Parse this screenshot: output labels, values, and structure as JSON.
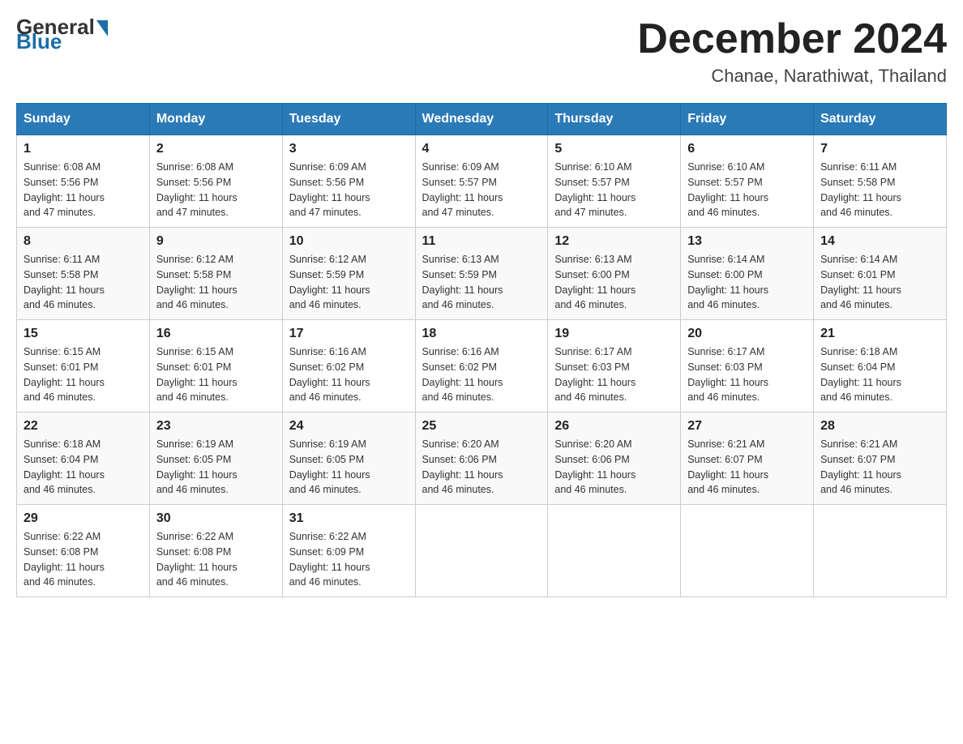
{
  "header": {
    "logo_general": "General",
    "logo_blue": "Blue",
    "month_title": "December 2024",
    "location": "Chanae, Narathiwat, Thailand"
  },
  "weekdays": [
    "Sunday",
    "Monday",
    "Tuesday",
    "Wednesday",
    "Thursday",
    "Friday",
    "Saturday"
  ],
  "weeks": [
    [
      {
        "day": "1",
        "sunrise": "6:08 AM",
        "sunset": "5:56 PM",
        "daylight": "11 hours and 47 minutes."
      },
      {
        "day": "2",
        "sunrise": "6:08 AM",
        "sunset": "5:56 PM",
        "daylight": "11 hours and 47 minutes."
      },
      {
        "day": "3",
        "sunrise": "6:09 AM",
        "sunset": "5:56 PM",
        "daylight": "11 hours and 47 minutes."
      },
      {
        "day": "4",
        "sunrise": "6:09 AM",
        "sunset": "5:57 PM",
        "daylight": "11 hours and 47 minutes."
      },
      {
        "day": "5",
        "sunrise": "6:10 AM",
        "sunset": "5:57 PM",
        "daylight": "11 hours and 47 minutes."
      },
      {
        "day": "6",
        "sunrise": "6:10 AM",
        "sunset": "5:57 PM",
        "daylight": "11 hours and 46 minutes."
      },
      {
        "day": "7",
        "sunrise": "6:11 AM",
        "sunset": "5:58 PM",
        "daylight": "11 hours and 46 minutes."
      }
    ],
    [
      {
        "day": "8",
        "sunrise": "6:11 AM",
        "sunset": "5:58 PM",
        "daylight": "11 hours and 46 minutes."
      },
      {
        "day": "9",
        "sunrise": "6:12 AM",
        "sunset": "5:58 PM",
        "daylight": "11 hours and 46 minutes."
      },
      {
        "day": "10",
        "sunrise": "6:12 AM",
        "sunset": "5:59 PM",
        "daylight": "11 hours and 46 minutes."
      },
      {
        "day": "11",
        "sunrise": "6:13 AM",
        "sunset": "5:59 PM",
        "daylight": "11 hours and 46 minutes."
      },
      {
        "day": "12",
        "sunrise": "6:13 AM",
        "sunset": "6:00 PM",
        "daylight": "11 hours and 46 minutes."
      },
      {
        "day": "13",
        "sunrise": "6:14 AM",
        "sunset": "6:00 PM",
        "daylight": "11 hours and 46 minutes."
      },
      {
        "day": "14",
        "sunrise": "6:14 AM",
        "sunset": "6:01 PM",
        "daylight": "11 hours and 46 minutes."
      }
    ],
    [
      {
        "day": "15",
        "sunrise": "6:15 AM",
        "sunset": "6:01 PM",
        "daylight": "11 hours and 46 minutes."
      },
      {
        "day": "16",
        "sunrise": "6:15 AM",
        "sunset": "6:01 PM",
        "daylight": "11 hours and 46 minutes."
      },
      {
        "day": "17",
        "sunrise": "6:16 AM",
        "sunset": "6:02 PM",
        "daylight": "11 hours and 46 minutes."
      },
      {
        "day": "18",
        "sunrise": "6:16 AM",
        "sunset": "6:02 PM",
        "daylight": "11 hours and 46 minutes."
      },
      {
        "day": "19",
        "sunrise": "6:17 AM",
        "sunset": "6:03 PM",
        "daylight": "11 hours and 46 minutes."
      },
      {
        "day": "20",
        "sunrise": "6:17 AM",
        "sunset": "6:03 PM",
        "daylight": "11 hours and 46 minutes."
      },
      {
        "day": "21",
        "sunrise": "6:18 AM",
        "sunset": "6:04 PM",
        "daylight": "11 hours and 46 minutes."
      }
    ],
    [
      {
        "day": "22",
        "sunrise": "6:18 AM",
        "sunset": "6:04 PM",
        "daylight": "11 hours and 46 minutes."
      },
      {
        "day": "23",
        "sunrise": "6:19 AM",
        "sunset": "6:05 PM",
        "daylight": "11 hours and 46 minutes."
      },
      {
        "day": "24",
        "sunrise": "6:19 AM",
        "sunset": "6:05 PM",
        "daylight": "11 hours and 46 minutes."
      },
      {
        "day": "25",
        "sunrise": "6:20 AM",
        "sunset": "6:06 PM",
        "daylight": "11 hours and 46 minutes."
      },
      {
        "day": "26",
        "sunrise": "6:20 AM",
        "sunset": "6:06 PM",
        "daylight": "11 hours and 46 minutes."
      },
      {
        "day": "27",
        "sunrise": "6:21 AM",
        "sunset": "6:07 PM",
        "daylight": "11 hours and 46 minutes."
      },
      {
        "day": "28",
        "sunrise": "6:21 AM",
        "sunset": "6:07 PM",
        "daylight": "11 hours and 46 minutes."
      }
    ],
    [
      {
        "day": "29",
        "sunrise": "6:22 AM",
        "sunset": "6:08 PM",
        "daylight": "11 hours and 46 minutes."
      },
      {
        "day": "30",
        "sunrise": "6:22 AM",
        "sunset": "6:08 PM",
        "daylight": "11 hours and 46 minutes."
      },
      {
        "day": "31",
        "sunrise": "6:22 AM",
        "sunset": "6:09 PM",
        "daylight": "11 hours and 46 minutes."
      },
      null,
      null,
      null,
      null
    ]
  ],
  "labels": {
    "sunrise": "Sunrise:",
    "sunset": "Sunset:",
    "daylight": "Daylight:"
  }
}
